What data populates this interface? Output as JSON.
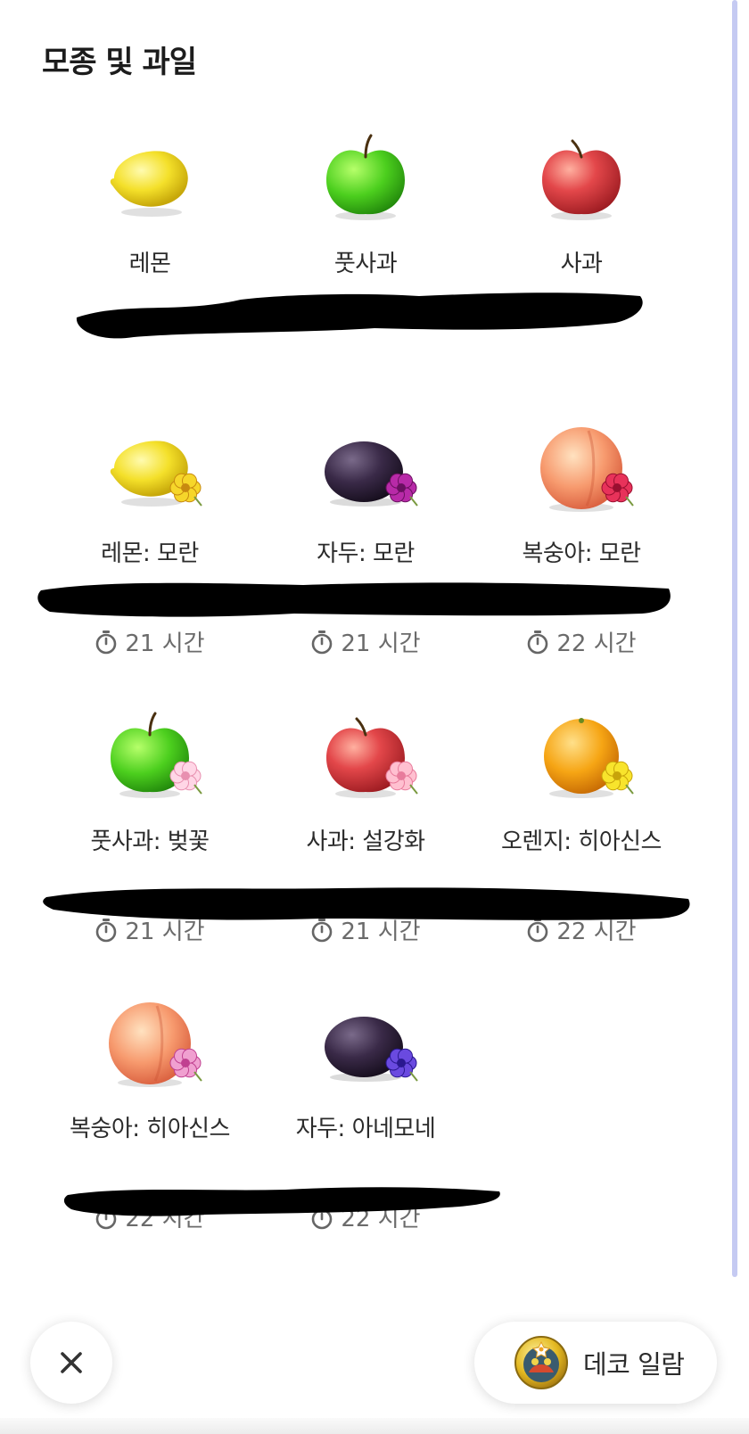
{
  "header": {
    "title": "모종 및 과일"
  },
  "rows": [
    {
      "items": [
        {
          "name": "레몬",
          "fruit": "lemon",
          "flower": null,
          "time": null
        },
        {
          "name": "풋사과",
          "fruit": "green-apple",
          "flower": null,
          "time": null
        },
        {
          "name": "사과",
          "fruit": "red-apple",
          "flower": null,
          "time": null
        }
      ]
    },
    {
      "items": [
        {
          "name": "레몬: 모란",
          "fruit": "lemon",
          "flower": "peony-yellow",
          "time": "21 시간"
        },
        {
          "name": "자두: 모란",
          "fruit": "plum",
          "flower": "peony-purple",
          "time": "21 시간"
        },
        {
          "name": "복숭아: 모란",
          "fruit": "peach",
          "flower": "peony-red",
          "time": "22 시간"
        }
      ]
    },
    {
      "items": [
        {
          "name": "풋사과: 벚꽃",
          "fruit": "green-apple",
          "flower": "cherry-blossom",
          "time": "21 시간"
        },
        {
          "name": "사과: 설강화",
          "fruit": "red-apple",
          "flower": "snowdrop",
          "time": "21 시간"
        },
        {
          "name": "오렌지: 히아신스",
          "fruit": "orange",
          "flower": "hyacinth-yellow",
          "time": "22 시간"
        }
      ]
    },
    {
      "items": [
        {
          "name": "복숭아: 히아신스",
          "fruit": "peach",
          "flower": "hyacinth-pink",
          "time": "22 시간"
        },
        {
          "name": "자두: 아네모네",
          "fruit": "plum",
          "flower": "anemone",
          "time": "22 시간"
        }
      ]
    }
  ],
  "footer": {
    "close_icon": "close-icon",
    "deco_label": "데코 일람",
    "deco_icon": "deco-badge-icon"
  }
}
